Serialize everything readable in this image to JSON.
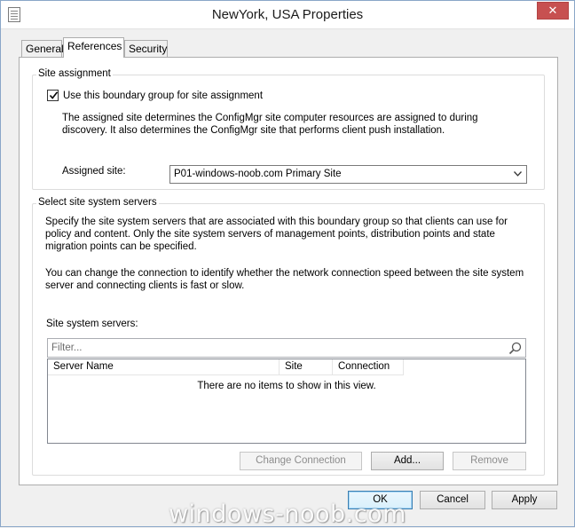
{
  "window": {
    "title": "NewYork, USA Properties",
    "close_glyph": "✕"
  },
  "tabs": [
    {
      "label": "General"
    },
    {
      "label": "References"
    },
    {
      "label": "Security"
    }
  ],
  "site_assignment": {
    "group_label": "Site assignment",
    "checkbox_label": "Use this boundary group for site assignment",
    "checkbox_checked": true,
    "description": "The assigned site determines the ConfigMgr site computer resources are assigned to during discovery. It also determines the ConfigMgr site that performs client push installation.",
    "assigned_site_label": "Assigned site:",
    "assigned_site_value": "P01-windows-noob.com Primary Site"
  },
  "site_servers": {
    "group_label": "Select site system servers",
    "description1": "Specify the site system servers that are associated with this boundary group so that clients can use for policy and content. Only the site system servers of management points, distribution points and state migration points can be specified.",
    "description2": "You can change the connection to identify whether the network connection speed between the site system server and connecting clients is fast or slow.",
    "list_label": "Site system servers:",
    "filter_placeholder": "Filter...",
    "columns": [
      "Server Name",
      "Site",
      "Connection"
    ],
    "empty_message": "There are no items to show in this view.",
    "buttons": {
      "change_connection": "Change Connection",
      "add": "Add...",
      "remove": "Remove"
    }
  },
  "footer": {
    "ok": "OK",
    "cancel": "Cancel",
    "apply": "Apply"
  },
  "watermark": "windows-noob.com",
  "icons": {
    "window_icon": "properties-sheet-icon",
    "filter_icon": "magnifier-icon",
    "dropdown_icon": "chevron-down-icon"
  }
}
